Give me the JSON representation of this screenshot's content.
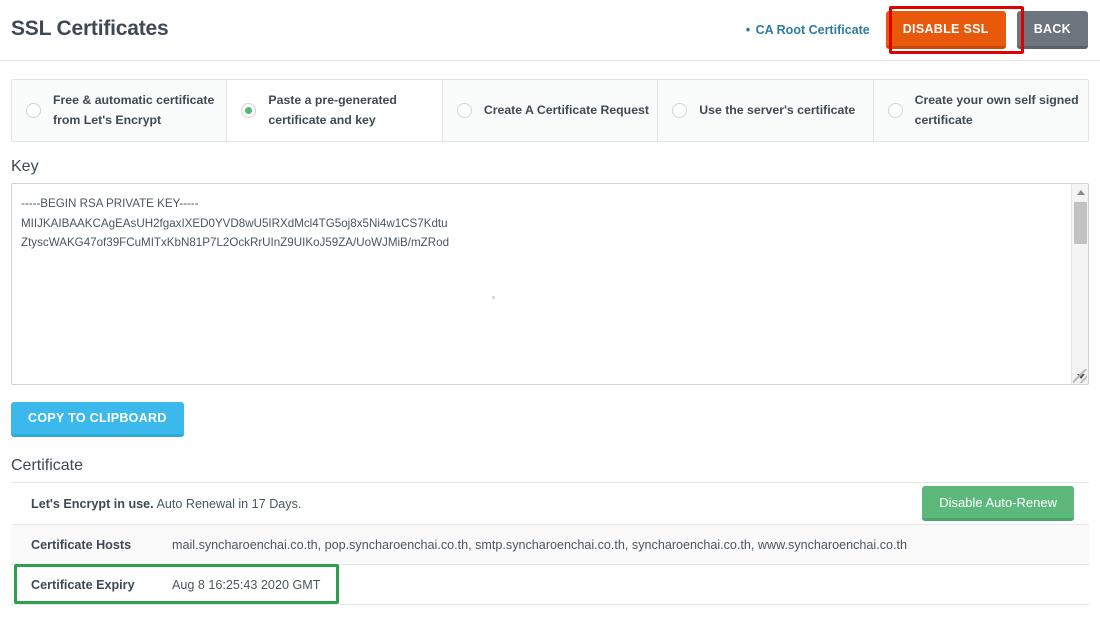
{
  "header": {
    "title": "SSL Certificates",
    "ca_root_link": "CA Root Certificate",
    "bullet": "•",
    "disable_ssl_button": "DISABLE SSL",
    "back_button": "BACK"
  },
  "options": [
    {
      "label": "Free & automatic certificate from Let's Encrypt",
      "selected": false
    },
    {
      "label": "Paste a pre-generated certificate and key",
      "selected": true
    },
    {
      "label": "Create A Certificate Request",
      "selected": false
    },
    {
      "label": "Use the server's certificate",
      "selected": false
    },
    {
      "label": "Create your own self signed certificate",
      "selected": false
    }
  ],
  "key_section": {
    "title": "Key",
    "value": "-----BEGIN RSA PRIVATE KEY-----\nMIIJKAIBAAKCAgEAsUH2fgaxIXED0YVD8wU5IRXdMcl4TG5oj8x5Ni4w1CS7Kdtu\nZtyscWAKG47of39FCuMITxKbN81P7L2OckRrUInZ9UIKoJ59ZA/UoWJMiB/mZRod",
    "copy_button": "COPY TO CLIPBOARD",
    "scroll_up_icon": "triangle-up-icon",
    "scroll_down_icon": "triangle-down-icon"
  },
  "certificate": {
    "title": "Certificate",
    "status_bold": "Let's Encrypt in use.",
    "status_rest": " Auto Renewal in 17 Days.",
    "auto_renew_button": "Disable Auto-Renew",
    "rows": [
      {
        "key": "Certificate Hosts",
        "value": "mail.syncharoenchai.co.th, pop.syncharoenchai.co.th, smtp.syncharoenchai.co.th, syncharoenchai.co.th, www.syncharoenchai.co.th"
      },
      {
        "key": "Certificate Expiry",
        "value": "Aug 8 16:25:43 2020 GMT"
      }
    ]
  },
  "annotations": {
    "red_highlight_color": "#e10000",
    "green_highlight_color": "#2f9e4f",
    "red_target": "disable-ssl-button",
    "green_target": "certificate-expiry-row"
  },
  "colors": {
    "orange": "#e8590c",
    "grey": "#6c757d",
    "blue": "#3bb9ec",
    "green": "#5cb97b",
    "link": "#2c7ba0",
    "radio_selected": "#4cbd72"
  }
}
